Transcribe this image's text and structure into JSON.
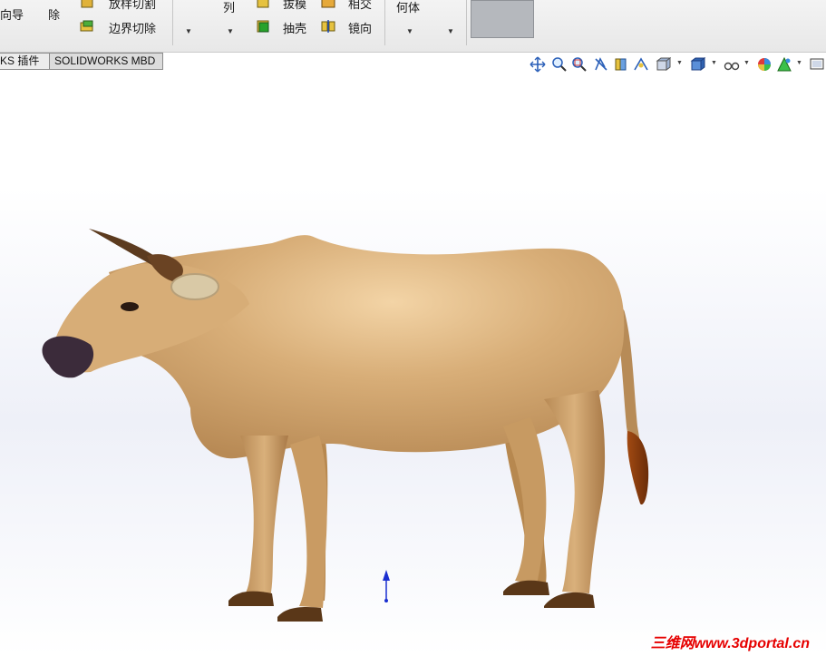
{
  "ribbon": {
    "wizard_partial": "向导",
    "remove_partial": "除",
    "loft_cut_partial": "放样切割",
    "boundary_cut": "边界切除",
    "pattern_partial": "列",
    "draft_partial": "拔模",
    "intersect_partial": "相交",
    "shell": "抽壳",
    "mirror": "镜向",
    "geometry_partial": "何体"
  },
  "tabs": [
    {
      "label": "KS 插件"
    },
    {
      "label": "SOLIDWORKS MBD"
    }
  ],
  "hud_icons": [
    "move-icon",
    "zoom-fit-icon",
    "zoom-area-icon",
    "previous-view-icon",
    "section-view-icon",
    "dynamic-annotation-icon",
    "view-orientation-icon",
    "display-style-icon",
    "hide-show-icon",
    "appearance-icon",
    "scene-icon",
    "view-settings-icon"
  ],
  "watermark": "三维网www.3dportal.cn",
  "colors": {
    "body": "#c9a06c",
    "horn": "#5a3a1e",
    "nose": "#3b2b3a",
    "tail_tip": "#7a3a10",
    "triad": "#1a2fd0"
  }
}
